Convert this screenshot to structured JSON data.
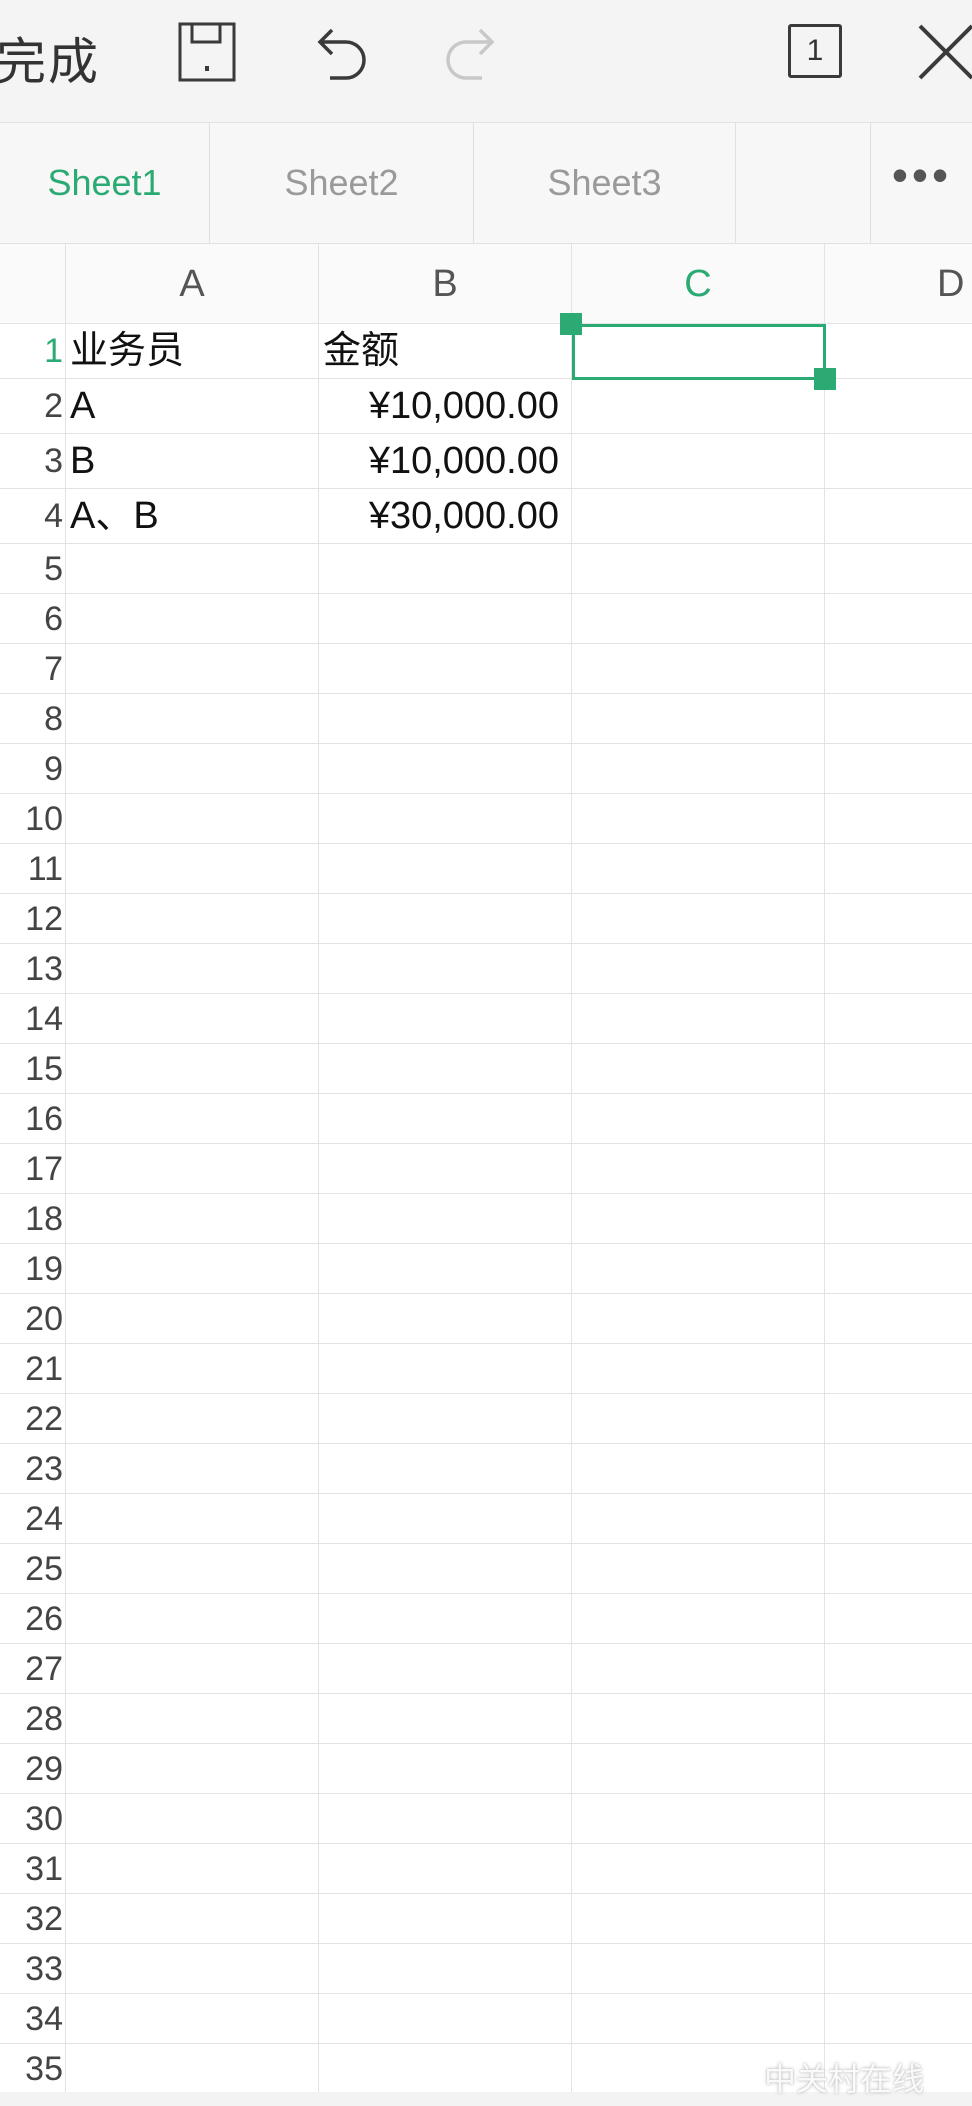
{
  "toolbar": {
    "done_label": "完成",
    "page_count": "1",
    "icons": [
      "save-icon",
      "undo-icon",
      "redo-icon",
      "close-icon"
    ]
  },
  "tabs": {
    "items": [
      {
        "label": "Sheet1",
        "active": true
      },
      {
        "label": "Sheet2",
        "active": false
      },
      {
        "label": "Sheet3",
        "active": false
      }
    ],
    "more_label": "•••"
  },
  "sheet": {
    "columns": [
      "A",
      "B",
      "C",
      "D"
    ],
    "selected_column": "C",
    "selected_cell": "C1",
    "rows": [
      {
        "num": "1",
        "A": "业务员",
        "B": "金额"
      },
      {
        "num": "2",
        "A": "A",
        "B": "¥10,000.00"
      },
      {
        "num": "3",
        "A": "B",
        "B": "¥10,000.00"
      },
      {
        "num": "4",
        "A": "A、B",
        "B": "¥30,000.00"
      },
      {
        "num": "5"
      },
      {
        "num": "6"
      },
      {
        "num": "7"
      },
      {
        "num": "8"
      },
      {
        "num": "9"
      },
      {
        "num": "10"
      },
      {
        "num": "11"
      },
      {
        "num": "12"
      },
      {
        "num": "13"
      },
      {
        "num": "14"
      },
      {
        "num": "15"
      },
      {
        "num": "16"
      },
      {
        "num": "17"
      },
      {
        "num": "18"
      },
      {
        "num": "19"
      },
      {
        "num": "20"
      },
      {
        "num": "21"
      },
      {
        "num": "22"
      },
      {
        "num": "23"
      },
      {
        "num": "24"
      },
      {
        "num": "25"
      },
      {
        "num": "26"
      },
      {
        "num": "27"
      },
      {
        "num": "28"
      },
      {
        "num": "29"
      },
      {
        "num": "30"
      },
      {
        "num": "31"
      },
      {
        "num": "32"
      },
      {
        "num": "33"
      },
      {
        "num": "34"
      },
      {
        "num": "35"
      }
    ]
  },
  "watermark": "中关村在线",
  "colors": {
    "accent": "#2bab73",
    "grid": "#e3e3e3",
    "toolbar_bg": "#f4f4f4"
  }
}
